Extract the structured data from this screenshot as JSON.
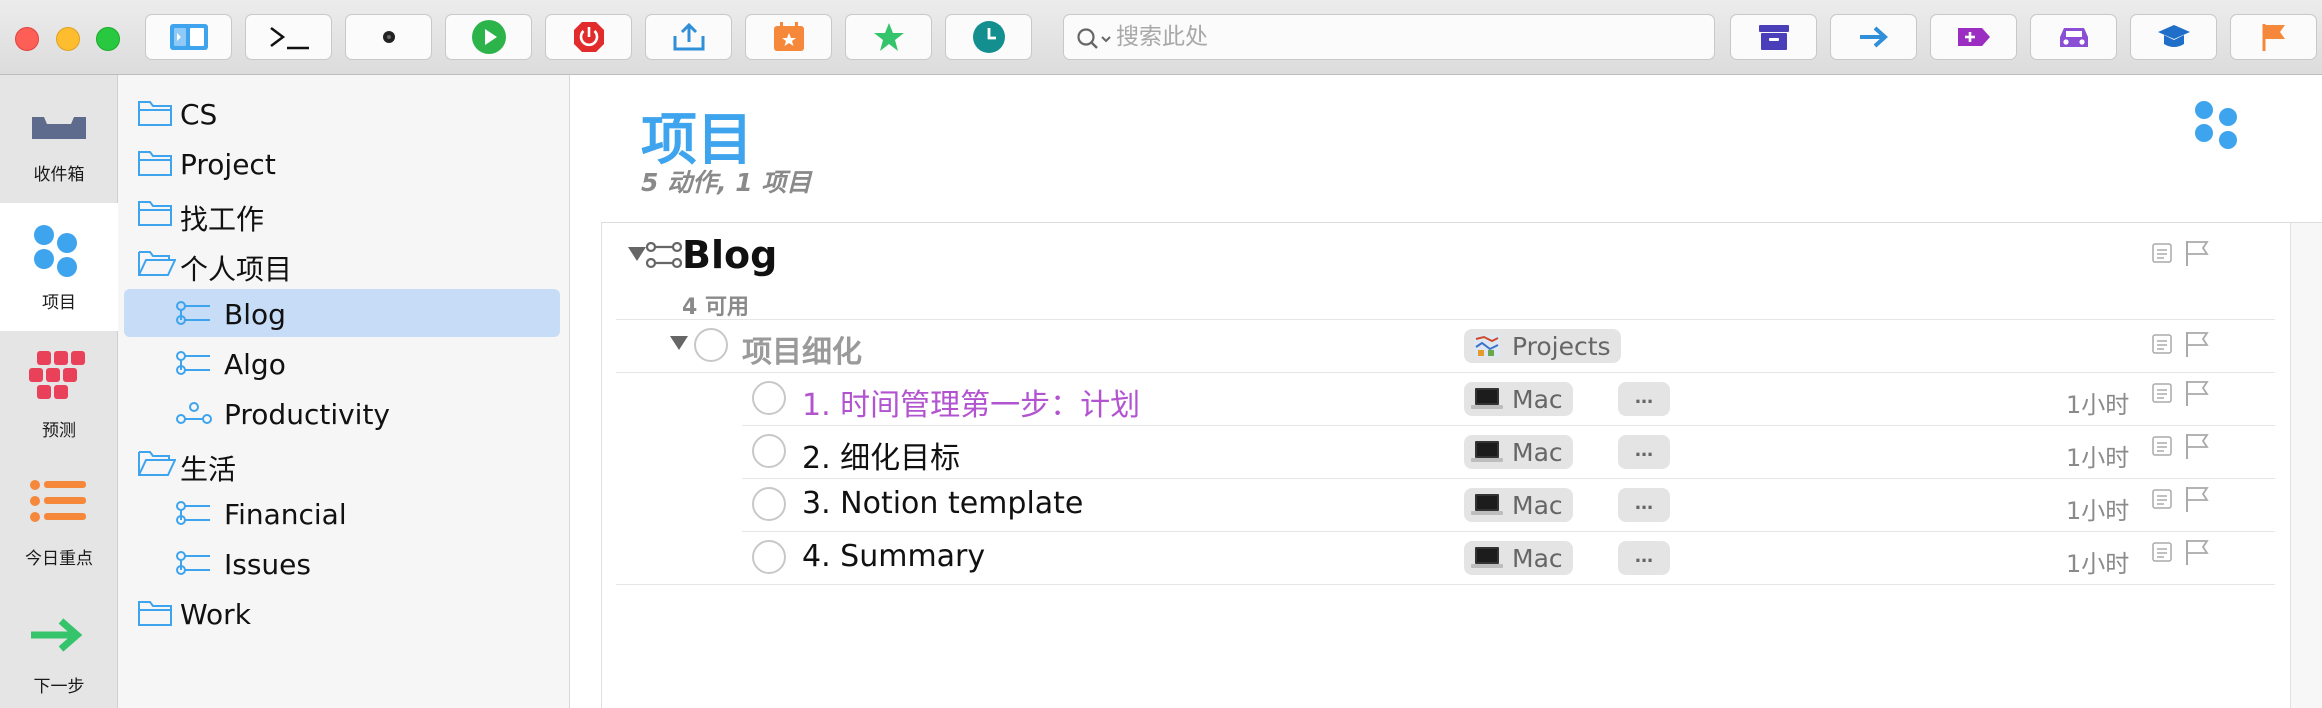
{
  "colors": {
    "accent_blue": "#3ea4ee",
    "forecast_red": "#e9415a",
    "flagged_orange": "#f5883a",
    "next_green": "#35c46b",
    "inbox_slate": "#5e6b8c",
    "overdue_purple": "#b253d0",
    "selection": "#c6dcf7"
  },
  "toolbar": {
    "buttons": [
      {
        "icon": "sidebar-toggle-icon"
      },
      {
        "icon": "terminal-icon"
      },
      {
        "icon": "record-icon"
      },
      {
        "icon": "play-icon"
      },
      {
        "icon": "power-icon"
      },
      {
        "icon": "share-icon"
      },
      {
        "icon": "calendar-icon"
      },
      {
        "icon": "star-icon"
      },
      {
        "icon": "clock-icon"
      },
      {
        "icon": "archive-icon"
      },
      {
        "icon": "move-arrow-icon"
      },
      {
        "icon": "add-tag-icon"
      },
      {
        "icon": "car-icon"
      },
      {
        "icon": "graduation-cap-icon"
      },
      {
        "icon": "flag-icon"
      }
    ],
    "search": {
      "placeholder": "搜索此处",
      "value": ""
    }
  },
  "perspectives": [
    {
      "label": "收件箱",
      "icon": "inbox-icon",
      "active": false
    },
    {
      "label": "项目",
      "icon": "projects-icon",
      "active": true
    },
    {
      "label": "预测",
      "icon": "forecast-icon",
      "active": false
    },
    {
      "label": "今日重点",
      "icon": "flagged-list-icon",
      "active": false
    },
    {
      "label": "下一步",
      "icon": "next-arrow-icon",
      "active": false
    }
  ],
  "sidebar": {
    "items": [
      {
        "label": "CS",
        "type": "folder"
      },
      {
        "label": "Project",
        "type": "folder"
      },
      {
        "label": "找工作",
        "type": "folder"
      },
      {
        "label": "个人项目",
        "type": "folder-open"
      },
      {
        "label": "Blog",
        "type": "project",
        "selected": true
      },
      {
        "label": "Algo",
        "type": "project"
      },
      {
        "label": "Productivity",
        "type": "project-single"
      },
      {
        "label": "生活",
        "type": "folder-open"
      },
      {
        "label": "Financial",
        "type": "project"
      },
      {
        "label": "Issues",
        "type": "project"
      },
      {
        "label": "Work",
        "type": "folder"
      }
    ]
  },
  "main": {
    "title": "项目",
    "subtitle": "5 动作, 1 项目",
    "project": {
      "name": "Blog",
      "available": "4 可用"
    },
    "group": {
      "title": "项目细化",
      "tag": "Projects"
    },
    "tasks": [
      {
        "title": "1. 时间管理第一步：计划",
        "tag": "Mac",
        "more": "...",
        "estimate": "1小时",
        "overdue": true
      },
      {
        "title": "2. 细化目标",
        "tag": "Mac",
        "more": "...",
        "estimate": "1小时",
        "overdue": false
      },
      {
        "title": "3. Notion template",
        "tag": "Mac",
        "more": "...",
        "estimate": "1小时",
        "overdue": false
      },
      {
        "title": "4. Summary",
        "tag": "Mac",
        "more": "...",
        "estimate": "1小时",
        "overdue": false
      }
    ]
  }
}
